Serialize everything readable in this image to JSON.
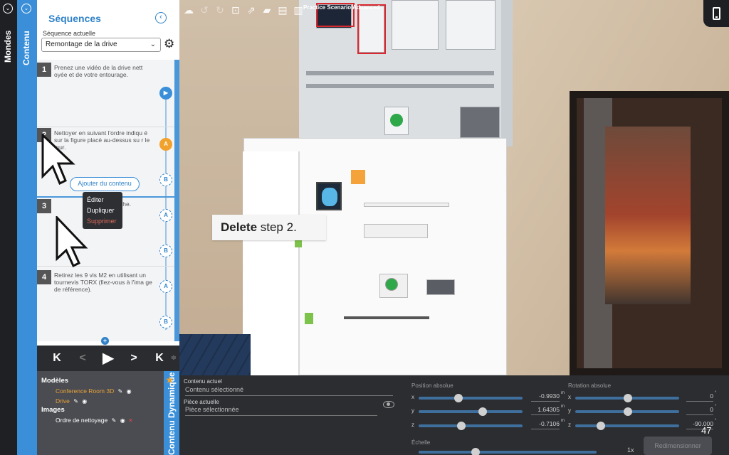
{
  "app": {
    "scenario_title": "Practice Scenario Advanced",
    "page_number": "47"
  },
  "rail": {
    "mondes_label": "Mondes",
    "contenu_label": "Contenu"
  },
  "sequences": {
    "title": "Séquences",
    "current_label": "Séquence actuelle",
    "current_value": "Remontage de la drive",
    "steps": [
      {
        "num": "1",
        "text": "Prenez une vidéo de la drive nett oyée et de votre entourage."
      },
      {
        "num": "2",
        "text": "Nettoyer en suivant l'ordre indiqu é sur la figure placé au-dessus su r le mur."
      },
      {
        "num": "3",
        "text": "boîtier de gauche."
      },
      {
        "num": "4",
        "text": "Retirez les 9 vis M2 en utilisant un tournevis TORX (fiez-vous à l'ima ge de référence)."
      }
    ],
    "node_labels": {
      "a": "A",
      "b": "B"
    },
    "add_content_label": "Ajouter du contenu"
  },
  "context_menu": {
    "items": [
      "Éditer",
      "Dupliquer",
      "Supprimer"
    ]
  },
  "player": {
    "first": "K",
    "prev": "<",
    "play": "▶",
    "next": ">",
    "last": "K"
  },
  "dynamic": {
    "tab_label": "Contenu Dynamique",
    "models_heading": "Modèles",
    "models": [
      "Conference Room 3D",
      "Drive"
    ],
    "images_heading": "Images",
    "images": [
      "Ordre de nettoyage"
    ]
  },
  "properties": {
    "current_content_label": "Contenu actuel",
    "current_content_value": "Contenu sélectionné",
    "current_part_label": "Pièce actuelle",
    "current_part_value": "Pièce sélectionnée",
    "position_label": "Position absolue",
    "rotation_label": "Rotation absolue",
    "scale_label": "Échelle",
    "position": {
      "x": "-0.9930",
      "y": "1.64305",
      "z": "-0.7106",
      "unit": "m"
    },
    "rotation": {
      "x": "0",
      "y": "0",
      "z": "-90.000",
      "unit": "°"
    },
    "scale_value": "1x",
    "resize_label": "Redimensionner"
  },
  "tooltip": {
    "bold": "Delete",
    "rest": " step 2."
  }
}
